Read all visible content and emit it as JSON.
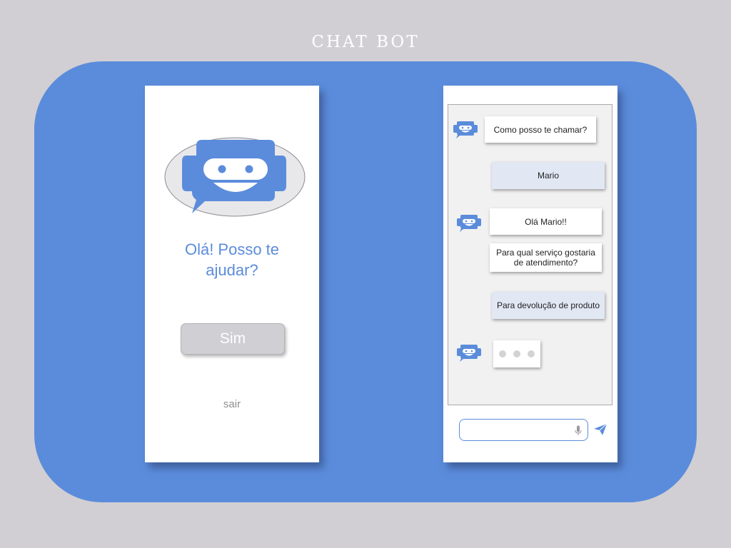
{
  "title": "CHAT BOT",
  "colors": {
    "brand": "#5b8cdb",
    "background": "#d1cfd3",
    "user_bubble": "#e2e7f4"
  },
  "welcome": {
    "greeting_line1": "Olá! Posso te",
    "greeting_line2": "ajudar?",
    "yes_button": "Sim",
    "exit_link": "sair",
    "icon": "robot-chat-icon"
  },
  "chat": {
    "messages": [
      {
        "from": "bot",
        "text": "Como posso te chamar?"
      },
      {
        "from": "user",
        "text": "Mario"
      },
      {
        "from": "bot",
        "text": "Olá Mario!!"
      },
      {
        "from": "bot",
        "text_line1": "Para qual serviço gostaria",
        "text_line2": "de atendimento?"
      },
      {
        "from": "user",
        "text": "Para devolução de produto"
      },
      {
        "from": "bot",
        "typing": true
      }
    ],
    "input": {
      "placeholder": "",
      "mic_icon": "microphone-icon",
      "send_icon": "send-icon"
    }
  }
}
